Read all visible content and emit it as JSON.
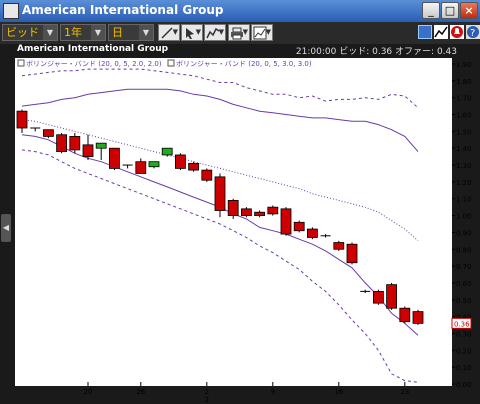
{
  "window": {
    "title": "American International Group",
    "minimize": "_",
    "maximize": "□",
    "close": "×"
  },
  "toolbar": {
    "side": "ビッド",
    "period": "1年",
    "interval": "日"
  },
  "chart": {
    "symbol_name": "American International Group",
    "time": "21:00:00",
    "bid_label": "ビッド",
    "bid_value": "0.36",
    "offer_label": "オファー",
    "offer_value": "0.43",
    "legend": [
      {
        "label": "ボリンジャー・バンド (20, 0, 5, 2.0, 2.0)",
        "color": "#6a3aa8"
      },
      {
        "label": "ボリンジャー・バンド (20, 0, 5, 3.0, 3.0)",
        "color": "#6a3aa8"
      }
    ],
    "current_price_tag": "0.36",
    "colors": {
      "up": "#22aa22",
      "down": "#cc0000",
      "band": "#6a3aa8",
      "background": "#ffffff"
    }
  },
  "chart_data": {
    "type": "candlestick",
    "ylim": [
      0.0,
      1.9
    ],
    "y_ticks": [
      "1.90",
      "1.80",
      "1.70",
      "1.60",
      "1.50",
      "1.40",
      "1.30",
      "1.20",
      "1.10",
      "1.00",
      "0.90",
      "0.80",
      "0.70",
      "0.60",
      "0.50",
      "0.40",
      "0.30",
      "0.20",
      "0.10",
      "0.00"
    ],
    "x_ticks": [
      {
        "label": "20",
        "index": 5
      },
      {
        "label": "26",
        "index": 9
      },
      {
        "label": "2",
        "index": 14
      },
      {
        "label": "9",
        "index": 19
      },
      {
        "label": "16",
        "index": 24
      },
      {
        "label": "23",
        "index": 29
      }
    ],
    "x_sub_label": "2",
    "candles": [
      {
        "o": 1.62,
        "h": 1.63,
        "c": 1.52,
        "l": 1.49
      },
      {
        "o": 1.52,
        "h": 1.52,
        "c": 1.52,
        "l": 1.5
      },
      {
        "o": 1.51,
        "h": 1.51,
        "c": 1.47,
        "l": 1.46
      },
      {
        "o": 1.48,
        "h": 1.49,
        "c": 1.38,
        "l": 1.37
      },
      {
        "o": 1.47,
        "h": 1.49,
        "c": 1.39,
        "l": 1.37
      },
      {
        "o": 1.42,
        "h": 1.48,
        "c": 1.35,
        "l": 1.33
      },
      {
        "o": 1.4,
        "h": 1.42,
        "c": 1.43,
        "l": 1.33
      },
      {
        "o": 1.4,
        "h": 1.4,
        "c": 1.28,
        "l": 1.27
      },
      {
        "o": 1.3,
        "h": 1.3,
        "c": 1.3,
        "l": 1.28
      },
      {
        "o": 1.32,
        "h": 1.34,
        "c": 1.25,
        "l": 1.25
      },
      {
        "o": 1.29,
        "h": 1.31,
        "c": 1.32,
        "l": 1.28
      },
      {
        "o": 1.36,
        "h": 1.4,
        "c": 1.4,
        "l": 1.35
      },
      {
        "o": 1.36,
        "h": 1.37,
        "c": 1.28,
        "l": 1.27
      },
      {
        "o": 1.31,
        "h": 1.32,
        "c": 1.27,
        "l": 1.26
      },
      {
        "o": 1.27,
        "h": 1.28,
        "c": 1.21,
        "l": 1.2
      },
      {
        "o": 1.23,
        "h": 1.25,
        "c": 1.03,
        "l": 0.99
      },
      {
        "o": 1.09,
        "h": 1.1,
        "c": 1.0,
        "l": 0.98
      },
      {
        "o": 1.04,
        "h": 1.05,
        "c": 1.0,
        "l": 0.99
      },
      {
        "o": 1.02,
        "h": 1.03,
        "c": 1.0,
        "l": 0.99
      },
      {
        "o": 1.05,
        "h": 1.06,
        "c": 1.01,
        "l": 1.0
      },
      {
        "o": 1.04,
        "h": 1.05,
        "c": 0.89,
        "l": 0.88
      },
      {
        "o": 0.96,
        "h": 0.97,
        "c": 0.91,
        "l": 0.9
      },
      {
        "o": 0.92,
        "h": 0.93,
        "c": 0.87,
        "l": 0.86
      },
      {
        "o": 0.88,
        "h": 0.89,
        "c": 0.88,
        "l": 0.87
      },
      {
        "o": 0.84,
        "h": 0.85,
        "c": 0.8,
        "l": 0.79
      },
      {
        "o": 0.83,
        "h": 0.84,
        "c": 0.72,
        "l": 0.71
      },
      {
        "o": 0.55,
        "h": 0.56,
        "c": 0.55,
        "l": 0.54
      },
      {
        "o": 0.55,
        "h": 0.56,
        "c": 0.48,
        "l": 0.47
      },
      {
        "o": 0.59,
        "h": 0.6,
        "c": 0.45,
        "l": 0.44
      },
      {
        "o": 0.45,
        "h": 0.46,
        "c": 0.37,
        "l": 0.36
      },
      {
        "o": 0.43,
        "h": 0.44,
        "c": 0.36,
        "l": 0.35
      }
    ],
    "series": [
      {
        "style": "solid",
        "values": [
          1.65,
          1.66,
          1.67,
          1.69,
          1.7,
          1.72,
          1.73,
          1.74,
          1.75,
          1.75,
          1.75,
          1.75,
          1.74,
          1.72,
          1.71,
          1.69,
          1.66,
          1.64,
          1.62,
          1.61,
          1.6,
          1.59,
          1.58,
          1.58,
          1.57,
          1.56,
          1.56,
          1.54,
          1.51,
          1.47,
          1.38
        ]
      },
      {
        "style": "dotted",
        "values": [
          1.57,
          1.56,
          1.54,
          1.52,
          1.5,
          1.48,
          1.46,
          1.44,
          1.42,
          1.4,
          1.38,
          1.36,
          1.34,
          1.32,
          1.3,
          1.28,
          1.26,
          1.24,
          1.22,
          1.2,
          1.18,
          1.16,
          1.13,
          1.11,
          1.09,
          1.07,
          1.05,
          1.02,
          0.97,
          0.92,
          0.85
        ]
      },
      {
        "style": "solid",
        "values": [
          1.48,
          1.47,
          1.45,
          1.41,
          1.37,
          1.34,
          1.32,
          1.29,
          1.26,
          1.23,
          1.2,
          1.17,
          1.14,
          1.11,
          1.08,
          1.05,
          1.01,
          0.98,
          0.93,
          0.91,
          0.89,
          0.86,
          0.83,
          0.79,
          0.74,
          0.69,
          0.6,
          0.52,
          0.42,
          0.36,
          0.29
        ]
      },
      {
        "style": "dashed",
        "values": [
          1.83,
          1.84,
          1.85,
          1.86,
          1.86,
          1.87,
          1.87,
          1.87,
          1.87,
          1.87,
          1.86,
          1.85,
          1.84,
          1.83,
          1.81,
          1.79,
          1.79,
          1.76,
          1.74,
          1.72,
          1.72,
          1.7,
          1.71,
          1.68,
          1.69,
          1.69,
          1.7,
          1.69,
          1.72,
          1.71,
          1.64
        ]
      },
      {
        "style": "dashed",
        "values": [
          1.39,
          1.38,
          1.36,
          1.32,
          1.28,
          1.25,
          1.22,
          1.19,
          1.16,
          1.13,
          1.1,
          1.07,
          1.04,
          1.01,
          0.98,
          0.95,
          0.91,
          0.87,
          0.82,
          0.78,
          0.73,
          0.68,
          0.61,
          0.55,
          0.47,
          0.38,
          0.3,
          0.2,
          0.06,
          0.02,
          0.01
        ]
      }
    ]
  }
}
